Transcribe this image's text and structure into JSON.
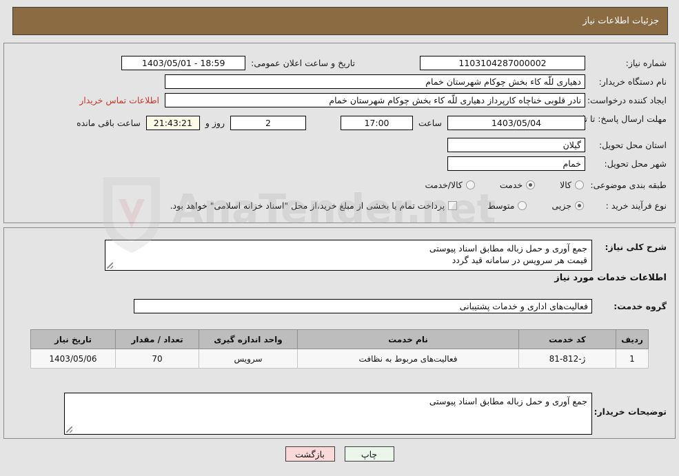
{
  "window": {
    "title": "جزئیات اطلاعات نیاز",
    "title_bg": "#8b6b42"
  },
  "need_info": {
    "need_number_label": "شماره نیاز:",
    "need_number_value": "1103104287000002",
    "announce_datetime_label": "تاریخ و ساعت اعلان عمومی:",
    "announce_datetime_value": "18:59 - 1403/05/01",
    "buyer_org_label": "نام دستگاه خریدار:",
    "buyer_org_value": "دهیاری للّه کاء بخش چوکام شهرستان خمام",
    "requester_label": "ایجاد کننده درخواست:",
    "requester_value": "نادر قلوبی خناچاه کارپرداز دهیاری للّه کاء بخش چوکام شهرستان خمام",
    "contact_link": "اطلاعات تماس خریدار",
    "deadline_label": "مهلت ارسال پاسخ: تا تاریخ:",
    "deadline_date": "1403/05/04",
    "deadline_hour_label": "ساعت",
    "deadline_hour_value": "17:00",
    "days_value": "2",
    "days_label": "روز و",
    "countdown_value": "21:43:21",
    "countdown_label": "ساعت باقی مانده",
    "province_label": "استان محل تحویل:",
    "province_value": "گیلان",
    "city_label": "شهر محل تحویل:",
    "city_value": "خمام",
    "category_label": "طبقه بندی موضوعی:",
    "category_options": [
      {
        "label": "کالا",
        "selected": false
      },
      {
        "label": "خدمت",
        "selected": true
      },
      {
        "label": "کالا/خدمت",
        "selected": false
      }
    ],
    "process_type_label": "نوع فرآیند خرید :",
    "process_options": [
      {
        "label": "جزیی",
        "selected": true
      },
      {
        "label": "متوسط",
        "selected": false
      }
    ],
    "treasury_checkbox_checked": false,
    "treasury_text": "پرداخت تمام یا بخشی از مبلغ خرید،از محل \"اسناد خزانه اسلامی\" خواهد بود."
  },
  "detail": {
    "general_desc_label": "شرح کلی نیاز:",
    "general_desc_value": "جمع آوری و حمل زباله مطابق اسناد پیوستی\nقیمت هر سرویس در سامانه قید گردد",
    "services_heading": "اطلاعات خدمات مورد نیاز",
    "service_group_label": "گروه خدمت:",
    "service_group_value": "فعالیت‌های اداری و خدمات پشتیبانی",
    "table": {
      "headers": [
        "ردیف",
        "کد خدمت",
        "نام خدمت",
        "واحد اندازه گیری",
        "تعداد / مقدار",
        "تاریخ نیاز"
      ],
      "rows": [
        {
          "index": "1",
          "code": "ژ-812-81",
          "name": "فعالیت‌های مربوط به نظافت",
          "unit": "سرویس",
          "quantity": "70",
          "need_date": "1403/05/06"
        }
      ]
    },
    "buyer_notes_label": "توضیحات خریدار:",
    "buyer_notes_value": "جمع آوری و حمل زباله مطابق اسناد پیوستی"
  },
  "footer": {
    "print_label": "چاپ",
    "back_label": "بازگشت"
  },
  "watermark": {
    "text": "AnaTender.net"
  }
}
